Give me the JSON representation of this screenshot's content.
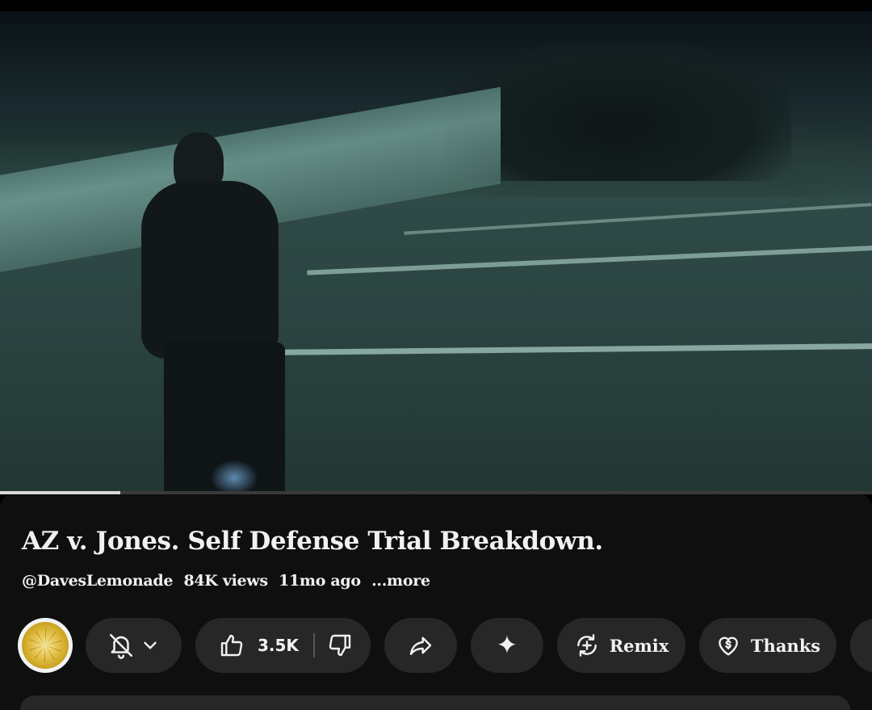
{
  "video": {
    "progress_fraction": 0.138
  },
  "title": "AZ v. Jones. Self Defense Trial Breakdown.",
  "meta": {
    "channel": "@DavesLemonade",
    "views": "84K views",
    "age": "11mo ago",
    "more": "...more"
  },
  "actions": {
    "like_count": "3.5K",
    "remix_label": "Remix",
    "thanks_label": "Thanks"
  },
  "icons": {
    "subscribe": "bell-off-icon",
    "dropdown": "chevron-down-icon",
    "like": "thumbs-up-icon",
    "dislike": "thumbs-down-icon",
    "share": "share-arrow-icon",
    "ask": "sparkle-icon",
    "remix": "remix-icon",
    "thanks": "heart-dollar-icon",
    "extra": "download-icon"
  },
  "colors": {
    "background": "#0f0f0f",
    "pill": "#272727",
    "text": "#f1f1f1"
  }
}
